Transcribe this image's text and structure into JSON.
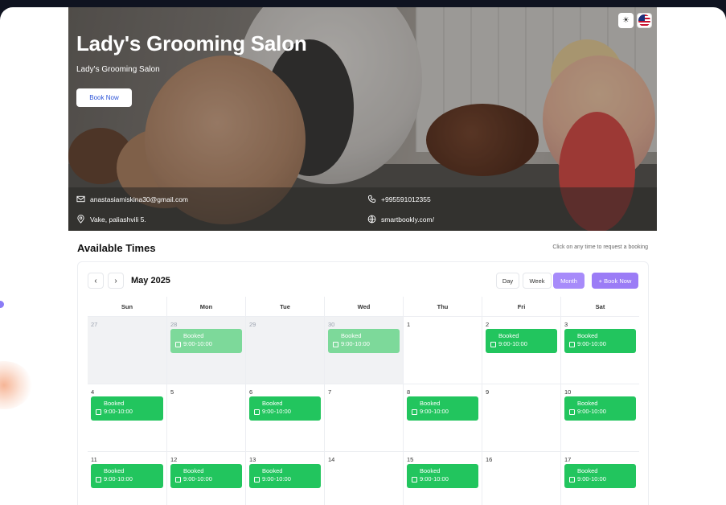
{
  "salon": {
    "name": "Lady's Grooming Salon",
    "subtitle": "Lady's Grooming Salon",
    "book_button": "Book Now",
    "email": "anastasiamiskina30@gmail.com",
    "phone": "+995591012355",
    "address": "Vake, paliashvili 5.",
    "website": "smartbookly.com/"
  },
  "section": {
    "title": "Available Times",
    "hint": "Click on any time to request a booking"
  },
  "calendar": {
    "month_label": "May 2025",
    "views": [
      "Day",
      "Week",
      "Month"
    ],
    "active_view": "Month",
    "book_now": "+ Book Now",
    "weekdays": [
      "Sun",
      "Mon",
      "Tue",
      "Wed",
      "Thu",
      "Fri",
      "Sat"
    ],
    "weeks": [
      [
        {
          "day": "27",
          "out": true,
          "booked": false
        },
        {
          "day": "28",
          "out": true,
          "booked": true
        },
        {
          "day": "29",
          "out": true,
          "booked": false
        },
        {
          "day": "30",
          "out": true,
          "booked": true
        },
        {
          "day": "1",
          "out": false,
          "booked": false
        },
        {
          "day": "2",
          "out": false,
          "booked": true
        },
        {
          "day": "3",
          "out": false,
          "booked": true
        }
      ],
      [
        {
          "day": "4",
          "out": false,
          "booked": true
        },
        {
          "day": "5",
          "out": false,
          "booked": false
        },
        {
          "day": "6",
          "out": false,
          "booked": true
        },
        {
          "day": "7",
          "out": false,
          "booked": false
        },
        {
          "day": "8",
          "out": false,
          "booked": true
        },
        {
          "day": "9",
          "out": false,
          "booked": false
        },
        {
          "day": "10",
          "out": false,
          "booked": true
        }
      ],
      [
        {
          "day": "11",
          "out": false,
          "booked": true
        },
        {
          "day": "12",
          "out": false,
          "booked": true
        },
        {
          "day": "13",
          "out": false,
          "booked": true
        },
        {
          "day": "14",
          "out": false,
          "booked": false
        },
        {
          "day": "15",
          "out": false,
          "booked": true
        },
        {
          "day": "16",
          "out": false,
          "booked": false
        },
        {
          "day": "17",
          "out": false,
          "booked": true
        }
      ]
    ],
    "event_title": "Booked",
    "event_time": "9:00-10:00"
  },
  "colors": {
    "accent": "#9b7cf6",
    "booked": "#22c55e",
    "booked_past": "#7dd99a",
    "link": "#2c54d8"
  },
  "icons": [
    "sun-icon",
    "us-flag-icon",
    "mail-icon",
    "phone-icon",
    "location-icon",
    "globe-icon",
    "calendar-icon",
    "chevron-left-icon",
    "chevron-right-icon"
  ]
}
